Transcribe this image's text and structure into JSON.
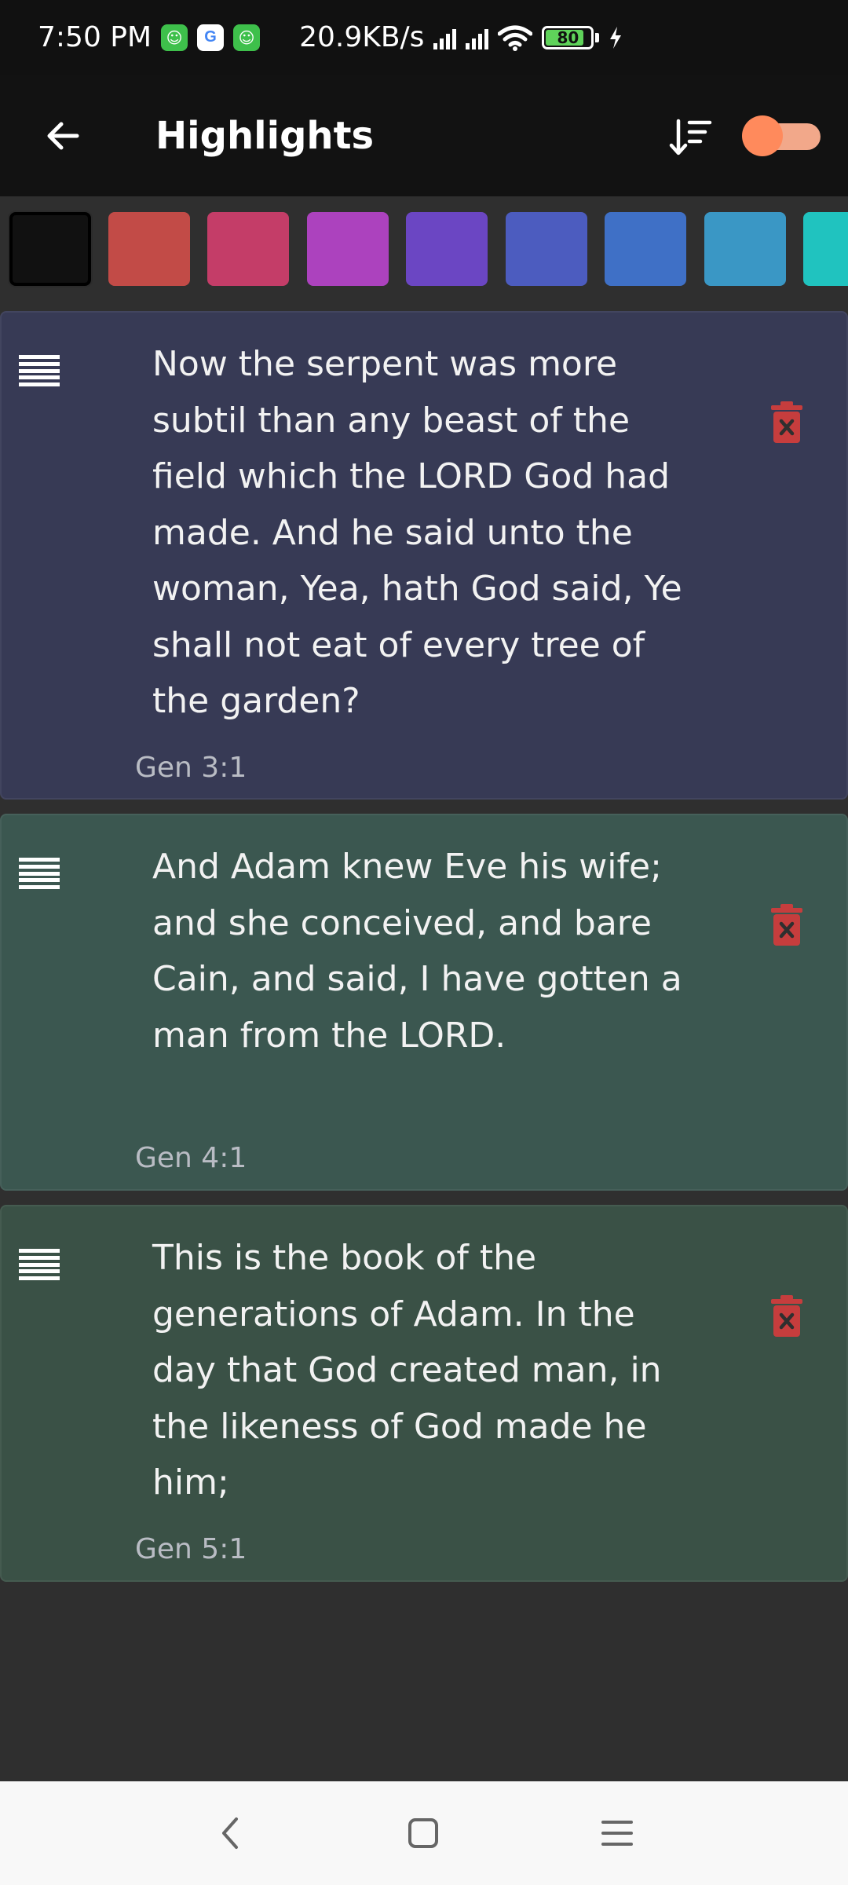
{
  "status_bar": {
    "time": "7:50 PM",
    "network_speed": "20.9KB/s",
    "battery": "80"
  },
  "app_bar": {
    "title": "Highlights",
    "toggle_on": false
  },
  "palette": {
    "colors": [
      "#111111",
      "#c24b47",
      "#c43d68",
      "#ac42be",
      "#6b46c3",
      "#4c5cbf",
      "#3f70c6",
      "#3a97c5",
      "#20c3bf"
    ],
    "selected_index": 0
  },
  "highlights": [
    {
      "text": "Now the serpent was more subtil than any beast of the field which the LORD God had made. And he said unto the woman, Yea, hath God said, Ye shall not eat of every tree of the garden?",
      "reference": "Gen 3:1",
      "color": "#373a55"
    },
    {
      "text": "And Adam knew Eve his wife; and she conceived, and bare Cain, and said, I have gotten a man from the LORD.",
      "reference": "Gen 4:1",
      "color": "#3b5750"
    },
    {
      "text": "This is the book of the generations of Adam. In the day that God created man, in the likeness of God made he him;",
      "reference": "Gen 5:1",
      "color": "#3a5146"
    }
  ],
  "icons": {
    "back": "arrow-left-icon",
    "sort": "sort-descending-icon",
    "handle": "drag-handle-icon",
    "delete": "trash-delete-icon"
  }
}
